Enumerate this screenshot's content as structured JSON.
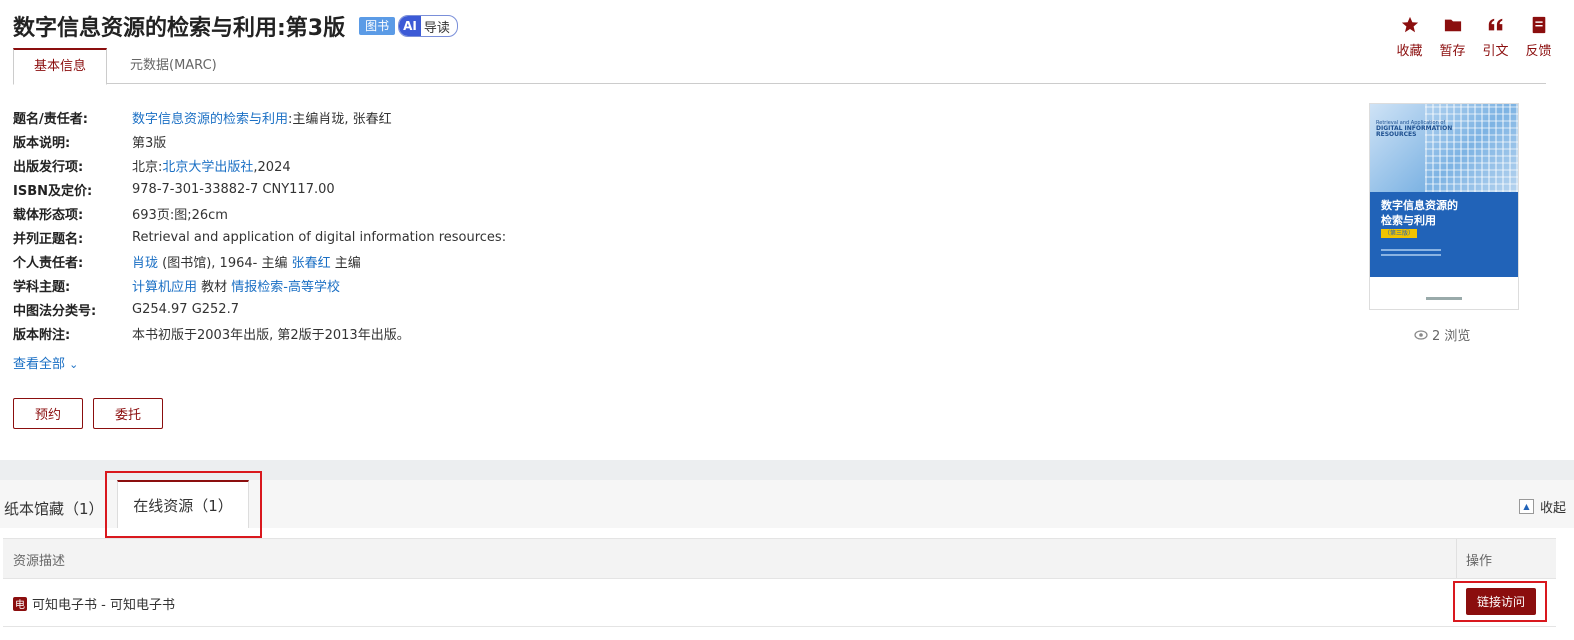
{
  "header": {
    "title": "数字信息资源的检索与利用:第3版",
    "badge_book": "图书",
    "ai_label": "AI",
    "ai_text": "导读"
  },
  "actions": [
    {
      "label": "收藏",
      "icon": "star-icon"
    },
    {
      "label": "暂存",
      "icon": "folder-icon"
    },
    {
      "label": "引文",
      "icon": "quote-icon"
    },
    {
      "label": "反馈",
      "icon": "feedback-icon"
    }
  ],
  "tabs": {
    "basic": "基本信息",
    "marc": "元数据(MARC)"
  },
  "info": {
    "title_resp": {
      "label": "题名/责任者:",
      "link": "数字信息资源的检索与利用",
      "rest": ":主编肖珑, 张春红"
    },
    "edition": {
      "label": "版本说明:",
      "value": "第3版"
    },
    "publish": {
      "label": "出版发行项:",
      "pre": "北京:",
      "link": "北京大学出版社",
      "post": ",2024"
    },
    "isbn": {
      "label": "ISBN及定价:",
      "value": "978-7-301-33882-7 CNY117.00"
    },
    "physical": {
      "label": "载体形态项:",
      "value": "693页:图;26cm"
    },
    "parallel": {
      "label": "并列正题名:",
      "value": "Retrieval and application of digital information resources:"
    },
    "person": {
      "label": "个人责任者:",
      "link1": "肖珑",
      "mid": " (图书馆), 1964- 主编 ",
      "link2": "张春红",
      "post": " 主编"
    },
    "subject": {
      "label": "学科主题:",
      "link1": "计算机应用",
      "mid": " 教材 ",
      "link2": "情报检索-高等学校"
    },
    "clc": {
      "label": "中图法分类号:",
      "value": "G254.97 G252.7"
    },
    "note": {
      "label": "版本附注:",
      "value": "本书初版于2003年出版, 第2版于2013年出版。"
    }
  },
  "more_label": "查看全部",
  "buttons": {
    "reserve": "预约",
    "entrust": "委托"
  },
  "cover": {
    "en_title": "Retrieval and Application of",
    "en_title2": "DIGITAL INFORMATION",
    "en_title3": "RESOURCES",
    "cn_title_line1": "数字信息资源的",
    "cn_title_line2": "检索与利用",
    "edition_tag": "（第三版）"
  },
  "views": "2 浏览",
  "holdings": {
    "paper_tab": "纸本馆藏（1）",
    "online_tab": "在线资源（1）",
    "collapse": "收起",
    "col_desc": "资源描述",
    "col_op": "操作",
    "row_icon_text": "电",
    "row_desc": "可知电子书 - 可知电子书",
    "visit_btn": "链接访问"
  },
  "colors": {
    "accent": "#8b0e0e",
    "link": "#1a6fc4",
    "highlight_box": "#d9181e"
  }
}
